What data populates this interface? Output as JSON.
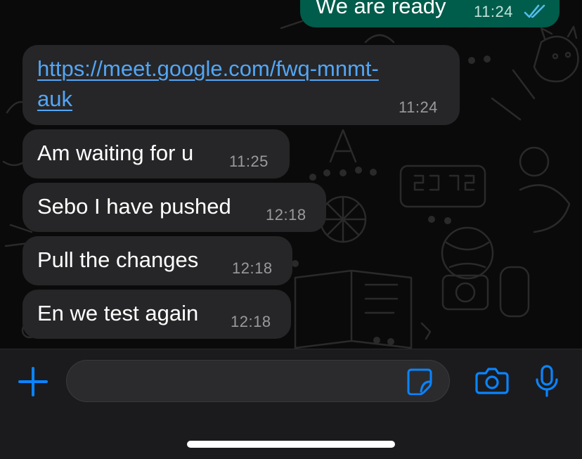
{
  "messages": [
    {
      "text": "We are ready",
      "time": "11:24",
      "direction": "outgoing",
      "status": "read",
      "status_icon": "double-check-icon"
    },
    {
      "text": "https://meet.google.com/fwq-mnmt-auk",
      "line1": "https://meet.google.com/fwq-mnmt-",
      "line2": "auk",
      "time": "11:24",
      "direction": "incoming",
      "is_link": true
    },
    {
      "text": "Am waiting for u",
      "time": "11:25",
      "direction": "incoming"
    },
    {
      "text": "Sebo I have pushed",
      "time": "12:18",
      "direction": "incoming"
    },
    {
      "text": "Pull the changes",
      "time": "12:18",
      "direction": "incoming"
    },
    {
      "text": "En we test again",
      "time": "12:18",
      "direction": "incoming"
    }
  ],
  "input_bar": {
    "message_value": "",
    "icons": [
      "plus-icon",
      "sticker-icon",
      "camera-icon",
      "microphone-icon"
    ]
  },
  "colors": {
    "accent": "#0a84ff",
    "outgoing_bubble": "#005c4b",
    "incoming_bubble": "#262628",
    "link": "#53a6f5",
    "read_ticks": "#53bdeb"
  }
}
